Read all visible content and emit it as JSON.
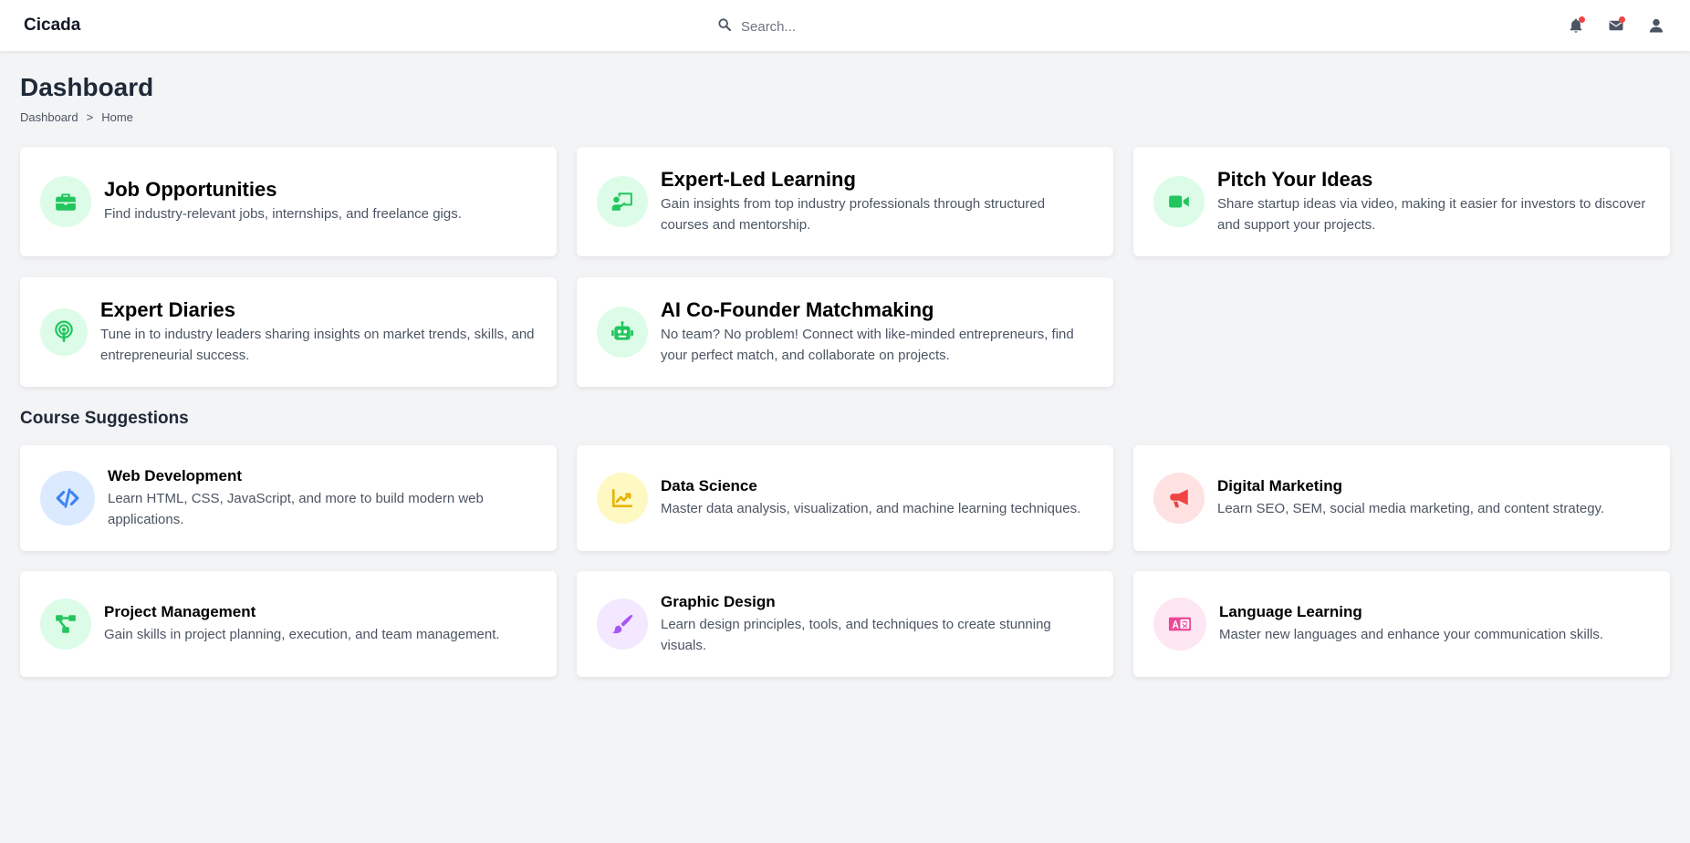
{
  "app": {
    "brand": "Cicada"
  },
  "search": {
    "placeholder": "Search..."
  },
  "page": {
    "title": "Dashboard"
  },
  "breadcrumb": {
    "items": [
      "Dashboard",
      "Home"
    ],
    "separator": ">"
  },
  "features": [
    {
      "title": "Job Opportunities",
      "description": "Find industry-relevant jobs, internships, and freelance gigs.",
      "icon": "briefcase-icon",
      "color": "#22c55e"
    },
    {
      "title": "Expert-Led Learning",
      "description": "Gain insights from top industry professionals through structured courses and mentorship.",
      "icon": "chalkboard-teacher-icon",
      "color": "#22c55e"
    },
    {
      "title": "Pitch Your Ideas",
      "description": "Share startup ideas via video, making it easier for investors to discover and support your projects.",
      "icon": "video-camera-icon",
      "color": "#22c55e"
    },
    {
      "title": "Expert Diaries",
      "description": "Tune in to industry leaders sharing insights on market trends, skills, and entrepreneurial success.",
      "icon": "podcast-icon",
      "color": "#22c55e"
    },
    {
      "title": "AI Co-Founder Matchmaking",
      "description": "No team? No problem! Connect with like-minded entrepreneurs, find your perfect match, and collaborate on projects.",
      "icon": "robot-icon",
      "color": "#22c55e"
    }
  ],
  "courses_section": {
    "title": "Course Suggestions"
  },
  "courses": [
    {
      "title": "Web Development",
      "description": "Learn HTML, CSS, JavaScript, and more to build modern web applications.",
      "icon": "code-icon",
      "color": "#3b82f6"
    },
    {
      "title": "Data Science",
      "description": "Master data analysis, visualization, and machine learning techniques.",
      "icon": "chart-line-icon",
      "color": "#eab308"
    },
    {
      "title": "Digital Marketing",
      "description": "Learn SEO, SEM, social media marketing, and content strategy.",
      "icon": "megaphone-icon",
      "color": "#ef4444"
    },
    {
      "title": "Project Management",
      "description": "Gain skills in project planning, execution, and team management.",
      "icon": "project-diagram-icon",
      "color": "#22c55e"
    },
    {
      "title": "Graphic Design",
      "description": "Learn design principles, tools, and techniques to create stunning visuals.",
      "icon": "paintbrush-icon",
      "color": "#a855f7"
    },
    {
      "title": "Language Learning",
      "description": "Master new languages and enhance your communication skills.",
      "icon": "language-icon",
      "color": "#ec4899"
    }
  ],
  "header_icons": [
    "bell-icon",
    "envelope-icon",
    "user-icon"
  ]
}
